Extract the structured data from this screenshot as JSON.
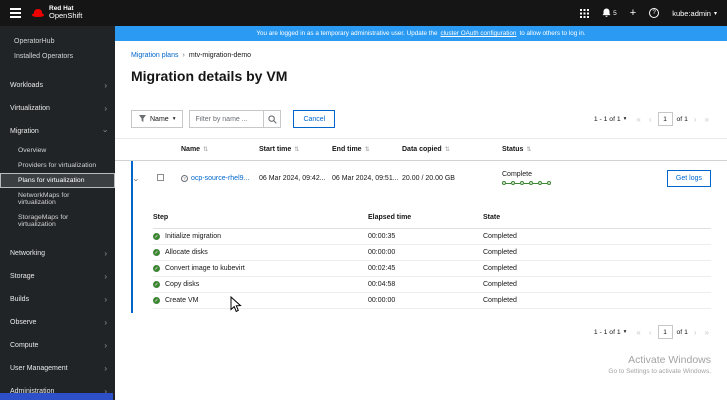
{
  "masthead": {
    "brand_top": "Red Hat",
    "brand_bottom": "OpenShift",
    "notification_count": "5",
    "username": "kube:admin"
  },
  "banner": {
    "prefix": "You are logged in as a temporary administrative user. Update the",
    "link_text": "cluster OAuth configuration",
    "suffix": "to allow others to log in."
  },
  "sidebar": {
    "static_items": [
      "OperatorHub",
      "Installed Operators"
    ],
    "expandables": [
      "Workloads",
      "Virtualization"
    ],
    "migration": {
      "label": "Migration",
      "children": [
        "Overview",
        "Providers for virtualization",
        "Plans for virtualization",
        "NetworkMaps for virtualization",
        "StorageMaps for virtualization"
      ]
    },
    "more": [
      "Networking",
      "Storage",
      "Builds",
      "Observe",
      "Compute",
      "User Management",
      "Administration"
    ]
  },
  "breadcrumb": {
    "parent": "Migration plans",
    "current": "mtv-migration-demo"
  },
  "page": {
    "title": "Migration details by VM"
  },
  "toolbar": {
    "filter_name": "Name",
    "placeholder": "Filter by name ...",
    "cancel": "Cancel"
  },
  "pagination": {
    "range": "1 - 1 of 1",
    "current": "1",
    "of": "of 1"
  },
  "table": {
    "headers": [
      "Name",
      "Start time",
      "End time",
      "Data copied",
      "Status"
    ],
    "row": {
      "name": "ocp-source-rhel9...",
      "start_time": "06 Mar 2024, 09:42...",
      "end_time": "06 Mar 2024, 09:51...",
      "data_copied": "20.00 / 20.00 GB",
      "status": "Complete",
      "action": "Get logs"
    },
    "steps_headers": [
      "Step",
      "Elapsed time",
      "State"
    ],
    "steps": [
      {
        "step": "Initialize migration",
        "elapsed": "00:00:35",
        "state": "Completed"
      },
      {
        "step": "Allocate disks",
        "elapsed": "00:00:00",
        "state": "Completed"
      },
      {
        "step": "Convert image to kubevirt",
        "elapsed": "00:02:45",
        "state": "Completed"
      },
      {
        "step": "Copy disks",
        "elapsed": "00:04:58",
        "state": "Completed"
      },
      {
        "step": "Create VM",
        "elapsed": "00:00:00",
        "state": "Completed"
      }
    ]
  },
  "watermark": {
    "line1": "Activate Windows",
    "line2": "Go to Settings to activate Windows."
  },
  "icons": {
    "sort": "⇅",
    "caret_down": "▾",
    "chevron_right": "›",
    "breadcrumb_separator": "›",
    "first_page": "«",
    "prev_page": "‹",
    "next_page": "›",
    "last_page": "»",
    "check": "✓",
    "question": "?",
    "plus": "+"
  },
  "colors": {
    "masthead_bg": "#151515",
    "sidebar_bg": "#212427",
    "banner": "#2b9af3",
    "link": "#0066cc",
    "success": "#3e8635"
  }
}
